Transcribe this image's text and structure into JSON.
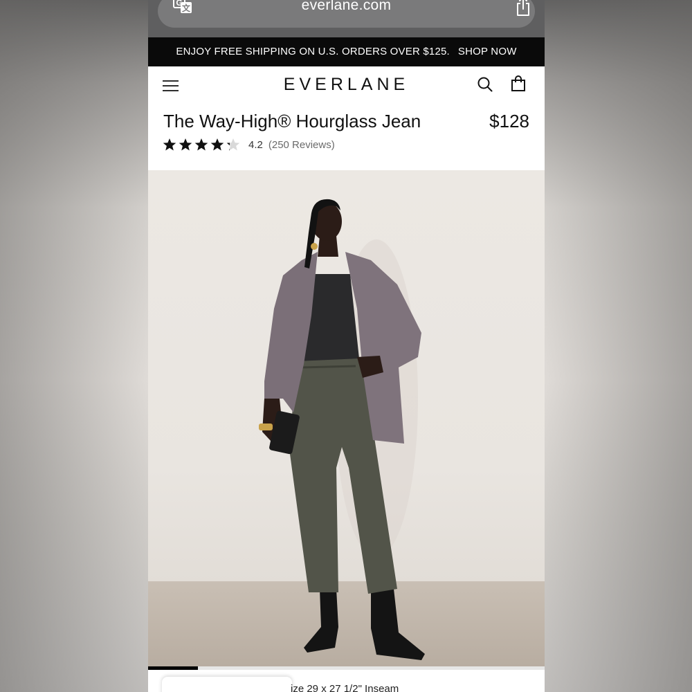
{
  "browser": {
    "url": "everlane.com",
    "translate_icon": "translate-icon",
    "share_icon": "share-icon"
  },
  "promo": {
    "text": "ENJOY FREE SHIPPING ON U.S. ORDERS OVER $125.",
    "cta": "SHOP NOW"
  },
  "header": {
    "logo": "EVERLANE",
    "menu_icon": "hamburger-menu-icon",
    "search_icon": "search-icon",
    "bag_icon": "shopping-bag-icon"
  },
  "product": {
    "title": "The Way-High® Hourglass Jean",
    "price": "$128",
    "rating_value": "4.2",
    "rating_stars": 4.2,
    "rating_max": 5,
    "review_count": "(250 Reviews)"
  },
  "gallery": {
    "image_alt": "Model wearing grey blazer, black top and washed black high-rise jeans with black boots",
    "progress_fraction": 0.125
  },
  "details": {
    "partial_text": "ize 29 x 27 1/2\" Inseam"
  },
  "colors": {
    "promo_bg": "#0a0a0a",
    "accent": "#000000"
  }
}
